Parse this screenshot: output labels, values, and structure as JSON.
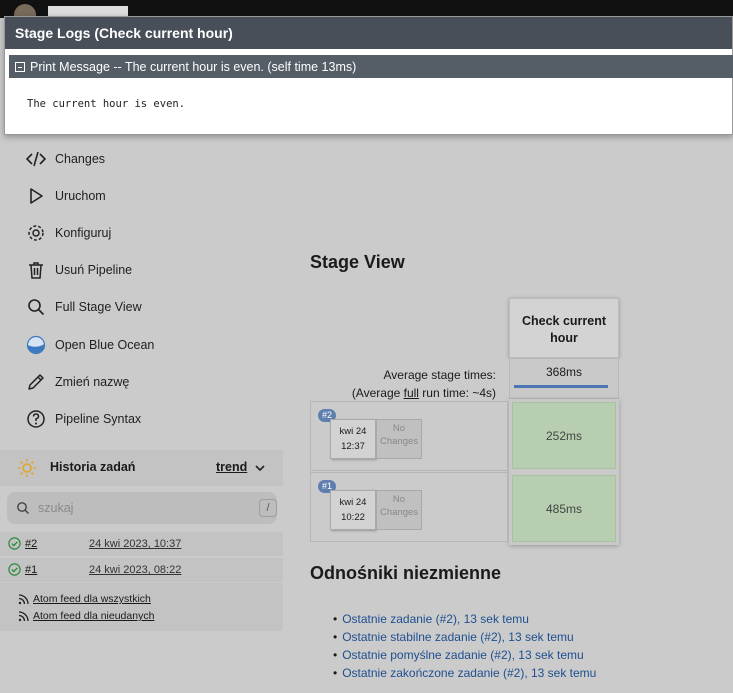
{
  "sidebar": {
    "tasks": [
      {
        "label": "Changes",
        "icon": "code-icon"
      },
      {
        "label": "Uruchom",
        "icon": "play-icon"
      },
      {
        "label": "Konfiguruj",
        "icon": "gear-icon"
      },
      {
        "label": "Usuń Pipeline",
        "icon": "trash-icon"
      },
      {
        "label": "Full Stage View",
        "icon": "search-icon"
      },
      {
        "label": "Open Blue Ocean",
        "icon": "blue-ocean-icon"
      },
      {
        "label": "Zmień nazwę",
        "icon": "pencil-icon"
      },
      {
        "label": "Pipeline Syntax",
        "icon": "help-icon"
      }
    ],
    "history": {
      "title": "Historia zadań",
      "trend": "trend"
    },
    "search": {
      "placeholder": "szukaj",
      "shortcut": "/"
    },
    "builds": [
      {
        "number": "#2",
        "date": "24 kwi 2023, 10:37"
      },
      {
        "number": "#1",
        "date": "24 kwi 2023, 08:22"
      }
    ],
    "feeds": {
      "all": "Atom feed dla wszystkich",
      "failed": "Atom feed dla nieudanych"
    }
  },
  "stage_view": {
    "title": "Stage View",
    "stage_name": "Check current hour",
    "avg_label_1": "Average stage times:",
    "avg_label_2_pre": "(Average ",
    "avg_label_2_link": "full",
    "avg_label_2_post": " run time: ~4s)",
    "avg_time": "368ms",
    "runs": [
      {
        "badge": "#2",
        "date": "kwi 24",
        "time": "12:37",
        "changes": "No Changes",
        "stage_time": "252ms"
      },
      {
        "badge": "#1",
        "date": "kwi 24",
        "time": "10:22",
        "changes": "No Changes",
        "stage_time": "485ms"
      }
    ]
  },
  "permalinks": {
    "title": "Odnośniki niezmienne",
    "items": [
      "Ostatnie zadanie (#2), 13 sek temu",
      "Ostatnie stabilne zadanie (#2), 13 sek temu",
      "Ostatnie pomyślne zadanie (#2), 13 sek temu",
      "Ostatnie zakończone zadanie (#2), 13 sek temu"
    ]
  },
  "modal": {
    "title": "Stage Logs (Check current hour)",
    "step": "Print Message -- The current hour is even. (self time 13ms)",
    "output": "The current hour is even."
  },
  "colors": {
    "modal_header": "#484f59",
    "success": "#b7cfb0",
    "link": "#1e4f8f",
    "badge": "#5e7fad"
  }
}
